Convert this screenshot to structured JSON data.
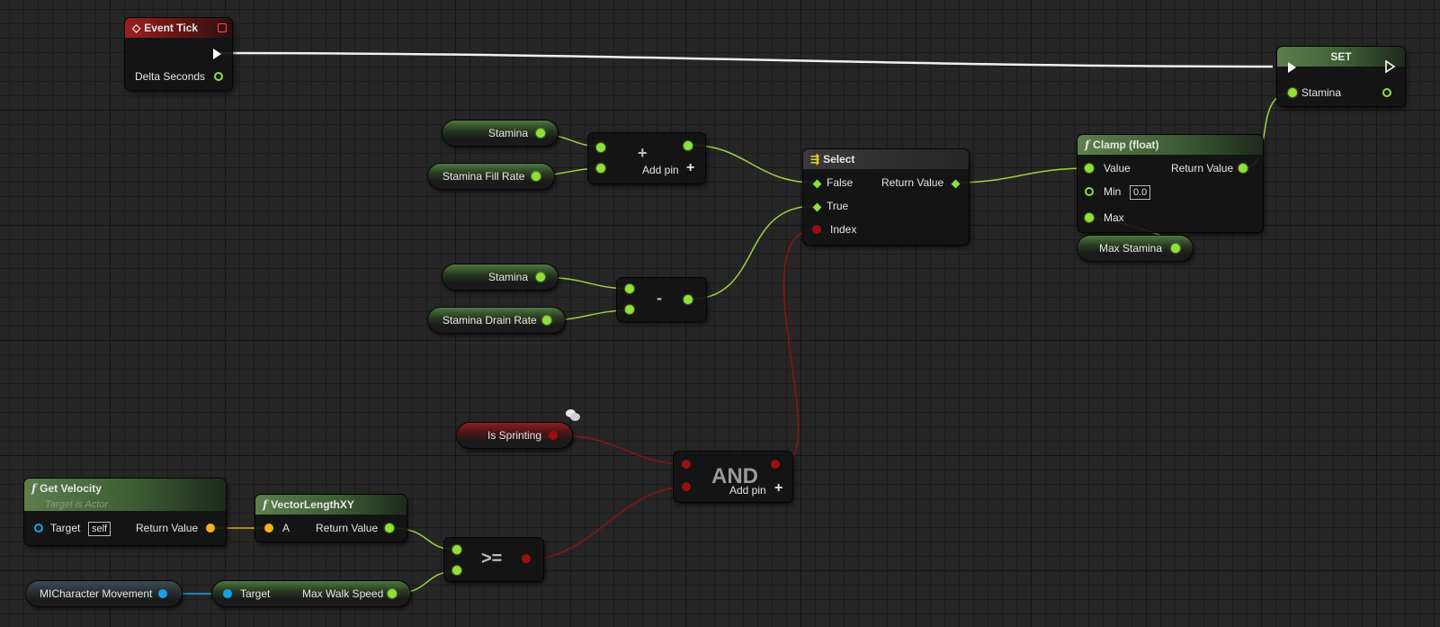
{
  "event_tick": {
    "title": "Event Tick",
    "delta_seconds": "Delta Seconds"
  },
  "set_node": {
    "title": "SET",
    "stamina": "Stamina"
  },
  "stamina_var_1": "Stamina",
  "stamina_fill_rate": "Stamina Fill Rate",
  "add_node": {
    "symbol": "+",
    "add_pin": "Add pin"
  },
  "stamina_var_2": "Stamina",
  "stamina_drain_rate": "Stamina Drain Rate",
  "subtract_node": {
    "symbol": "-"
  },
  "select_node": {
    "title": "Select",
    "false": "False",
    "true": "True",
    "index": "Index",
    "return_value": "Return Value"
  },
  "clamp_node": {
    "title": "Clamp (float)",
    "value": "Value",
    "min": "Min",
    "min_value": "0.0",
    "max": "Max",
    "return_value": "Return Value"
  },
  "max_stamina": "Max Stamina",
  "is_sprinting": "Is Sprinting",
  "and_node": {
    "title": "AND",
    "add_pin": "Add pin"
  },
  "get_velocity": {
    "title": "Get Velocity",
    "subtitle": "Target is Actor",
    "target": "Target",
    "target_value": "self",
    "return_value": "Return Value"
  },
  "vector_length": {
    "title": "VectorLengthXY",
    "a": "A",
    "return_value": "Return Value"
  },
  "gte_node": {
    "symbol": ">="
  },
  "character_movement": "MICharacter Movement",
  "max_walk_speed_node": {
    "target": "Target",
    "max_walk_speed": "Max Walk Speed"
  },
  "icons": {
    "event": "event-diamond-icon",
    "function": "function-f-icon",
    "select": "select-icon",
    "plus": "plus-icon",
    "comment_bubble": "comment-bubble-icon"
  },
  "colors": {
    "float_pin": "#8fe03a",
    "bool_pin": "#9c0f0f",
    "vector_pin": "#f2b21a",
    "object_pin": "#18a2e6",
    "exec_wire": "#ffffff",
    "background": "#262626"
  }
}
